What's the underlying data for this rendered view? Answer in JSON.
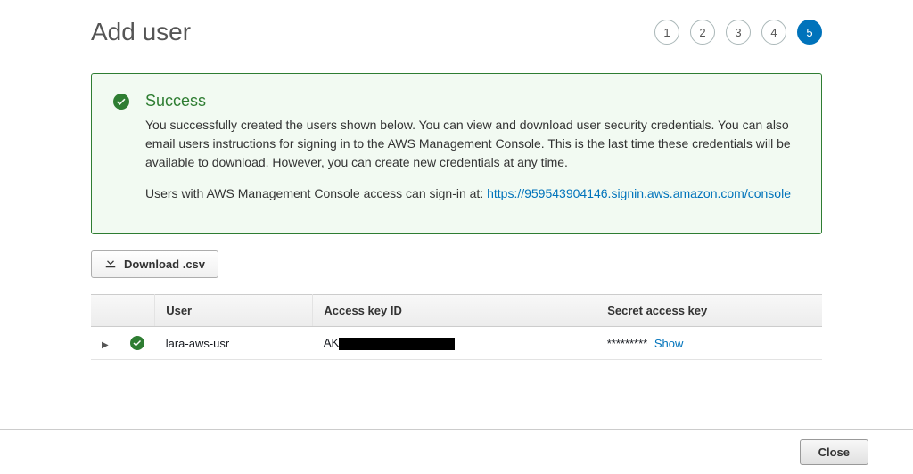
{
  "page": {
    "title": "Add user"
  },
  "steps": {
    "items": [
      "1",
      "2",
      "3",
      "4",
      "5"
    ],
    "active_index": 4
  },
  "alert": {
    "title": "Success",
    "paragraph1": "You successfully created the users shown below. You can view and download user security credentials. You can also email users instructions for signing in to the AWS Management Console. This is the last time these credentials will be available to download. However, you can create new credentials at any time.",
    "signin_prefix": "Users with AWS Management Console access can sign-in at: ",
    "signin_url": "https://959543904146.signin.aws.amazon.com/console"
  },
  "download": {
    "label": "Download .csv"
  },
  "table": {
    "headers": {
      "user": "User",
      "access_key_id": "Access key ID",
      "secret_access_key": "Secret access key"
    },
    "rows": [
      {
        "user": "lara-aws-usr",
        "access_key_prefix": "AK",
        "secret_masked": "*********",
        "show_label": "Show"
      }
    ]
  },
  "footer": {
    "close_label": "Close"
  }
}
